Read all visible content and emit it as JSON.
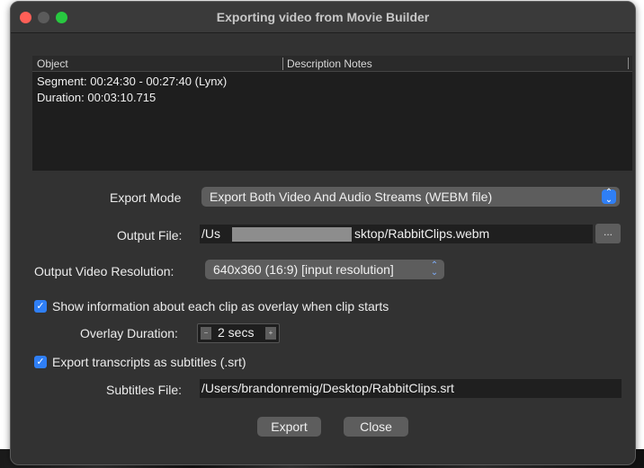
{
  "window": {
    "title": "Exporting video from Movie Builder"
  },
  "list": {
    "headers": [
      "Object",
      "Description Notes"
    ],
    "rows": [
      "Segment: 00:24:30 - 00:27:40 (Lynx)",
      "Duration: 00:03:10.715"
    ]
  },
  "export_mode": {
    "label": "Export Mode",
    "value": "Export Both Video And Audio Streams (WEBM file)"
  },
  "output_file": {
    "label": "Output File:",
    "value_start": "/Us",
    "value_end": "sktop/RabbitClips.webm",
    "browse_label": "..."
  },
  "resolution": {
    "label": "Output Video Resolution:",
    "value": "640x360 (16:9) [input resolution]"
  },
  "overlay": {
    "checkbox_label": "Show information about each clip as overlay when clip starts",
    "checked": true,
    "duration_label": "Overlay Duration:",
    "duration_value": "2 secs"
  },
  "transcripts": {
    "checkbox_label": "Export transcripts as subtitles (.srt)",
    "checked": true
  },
  "subtitles_file": {
    "label": "Subtitles File:",
    "value": "/Users/brandonremig/Desktop/RabbitClips.srt"
  },
  "buttons": {
    "export": "Export",
    "close": "Close"
  },
  "colors": {
    "accent": "#2f7ff6",
    "window_bg": "#323232",
    "field_bg": "#1f1f1f",
    "control_bg": "#5d5d5d"
  }
}
